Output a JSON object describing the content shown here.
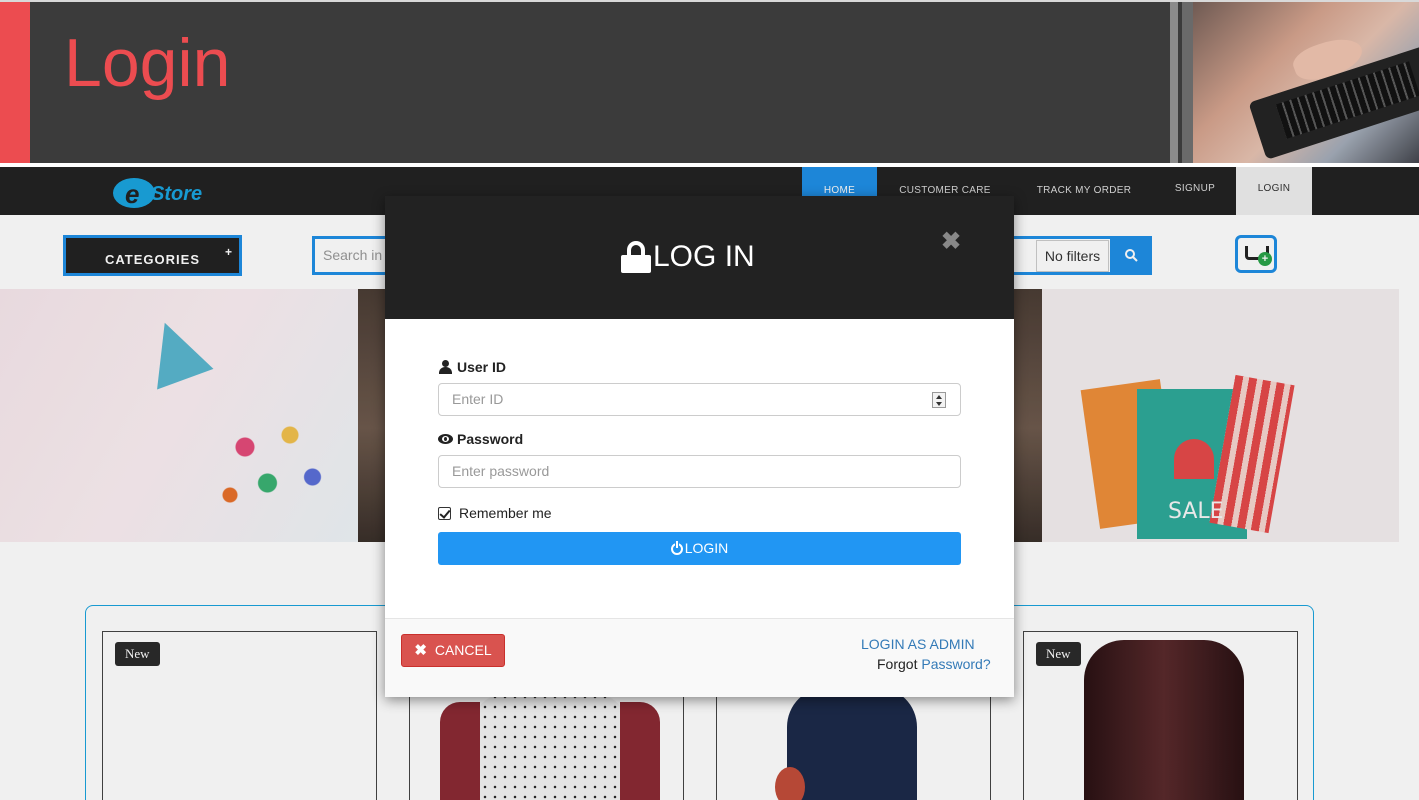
{
  "banner": {
    "title": "Login"
  },
  "navbar": {
    "logo_prefix": "e",
    "logo_suffix": "Store",
    "items": [
      {
        "label": "HOME"
      },
      {
        "label": "CUSTOMER CARE"
      },
      {
        "label": "TRACK MY ORDER"
      },
      {
        "label": "SIGNUP"
      },
      {
        "label": "LOGIN"
      }
    ]
  },
  "toolbar": {
    "categories_label": "CATEGORIES",
    "categories_icon": "+",
    "search_placeholder": "Search in",
    "filters_value": "No filters"
  },
  "slider": {
    "sale_text": "SALE"
  },
  "products": {
    "items": [
      {
        "badge": "New"
      },
      {
        "badge": ""
      },
      {
        "badge": ""
      },
      {
        "badge": "New"
      }
    ]
  },
  "modal": {
    "title": "LOG IN",
    "close_symbol": "✖",
    "user_label": "User ID",
    "user_placeholder": "Enter ID",
    "password_label": "Password",
    "password_placeholder": "Enter password",
    "remember_label": "Remember me",
    "remember_checked": true,
    "login_button": "LOGIN",
    "cancel_button": "CANCEL",
    "cancel_icon": "✖",
    "admin_link": "LOGIN AS ADMIN",
    "forgot_prefix": "Forgot",
    "forgot_link": "Password?"
  },
  "colors": {
    "accent": "#ec4c50",
    "primary_blue": "#2196f3",
    "danger": "#d9534f",
    "link": "#337ab7",
    "dark": "#222222"
  }
}
